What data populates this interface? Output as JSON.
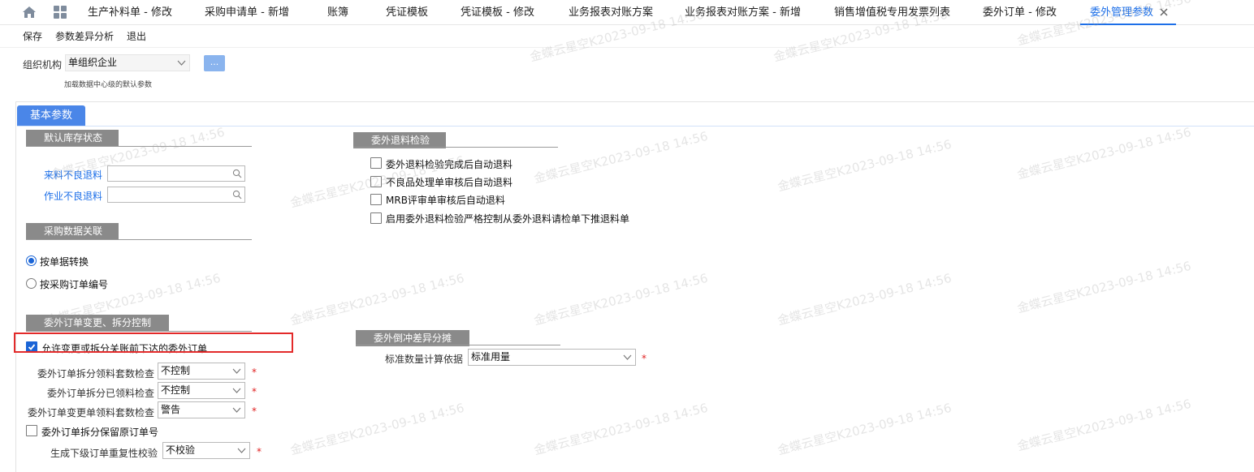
{
  "tabs": [
    {
      "label": "生产补料单 - 修改",
      "active": false
    },
    {
      "label": "采购申请单 - 新增",
      "active": false
    },
    {
      "label": "账簿",
      "active": false
    },
    {
      "label": "凭证模板",
      "active": false
    },
    {
      "label": "凭证模板 - 修改",
      "active": false
    },
    {
      "label": "业务报表对账方案",
      "active": false
    },
    {
      "label": "业务报表对账方案 - 新增",
      "active": false
    },
    {
      "label": "销售增值税专用发票列表",
      "active": false
    },
    {
      "label": "委外订单 - 修改",
      "active": false
    },
    {
      "label": "委外管理参数",
      "active": true
    }
  ],
  "toolbar": {
    "save": "保存",
    "diff": "参数差异分析",
    "exit": "退出"
  },
  "org": {
    "label": "组织机构",
    "value": "单组织企业",
    "more_button": "...",
    "hint": "加载数据中心级的默认参数"
  },
  "section_tab": "基本参数",
  "default_stock": {
    "title": "默认库存状态",
    "incoming_bad_label": "来料不良退料",
    "incoming_bad_value": "",
    "operation_bad_label": "作业不良退料",
    "operation_bad_value": ""
  },
  "return_inspection": {
    "title": "委外退料检验",
    "options": [
      {
        "label": "委外退料检验完成后自动退料",
        "checked": false
      },
      {
        "label": "不良品处理单审核后自动退料",
        "checked": false
      },
      {
        "label": "MRB评审单审核后自动退料",
        "checked": false
      },
      {
        "label": "启用委外退料检验严格控制从委外退料请检单下推退料单",
        "checked": false
      }
    ]
  },
  "purchase_link": {
    "title": "采购数据关联",
    "options": [
      {
        "label": "按单据转换",
        "selected": true
      },
      {
        "label": "按采购订单编号",
        "selected": false
      }
    ]
  },
  "order_change": {
    "title": "委外订单变更、拆分控制",
    "allow_label": "允许变更或拆分关账前下达的委外订单",
    "allow_checked": true,
    "fields": [
      {
        "label": "委外订单拆分领料套数检查",
        "value": "不控制",
        "required": "*"
      },
      {
        "label": "委外订单拆分已领料检查",
        "value": "不控制",
        "required": "*"
      },
      {
        "label": "委外订单变更单领料套数检查",
        "value": "警告",
        "required": "*"
      }
    ],
    "keep_no_label": "委外订单拆分保留原订单号",
    "keep_no_checked": false,
    "dup_check_label": "生成下级订单重复性校验",
    "dup_check_value": "不校验",
    "dup_check_required": "*"
  },
  "reverse_diff": {
    "title": "委外倒冲差异分摊",
    "basis_label": "标准数量计算依据",
    "basis_value": "标准用量",
    "required": "*"
  },
  "watermark": "金蝶云星空K2023-09-18 14:56",
  "colors": {
    "accent": "#1d6fe8",
    "section_tab": "#4a86e8",
    "group_header": "#8a8a8a",
    "required": "#e02020",
    "highlight": "#e32a2a"
  }
}
